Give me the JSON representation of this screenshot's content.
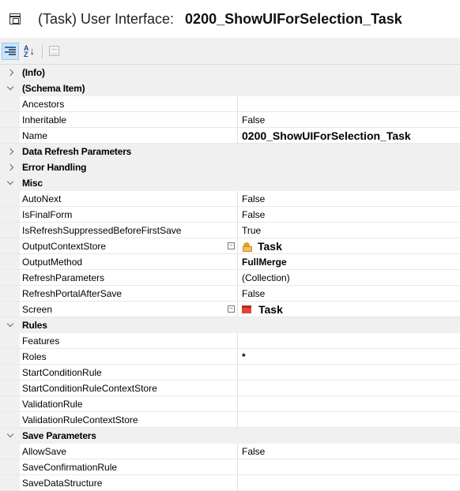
{
  "title": {
    "prefix": "(Task) User Interface:",
    "name": "0200_ShowUIForSelection_Task"
  },
  "toolbar": {
    "categorized_icon": "categorized-icon",
    "alphabetical_icon": "sort-az-icon",
    "az_top": "A",
    "az_bottom": "Z",
    "az_arrow": "↓",
    "property_pages_icon": "property-pages-icon"
  },
  "categories": {
    "info": {
      "label": "(Info)"
    },
    "schema": {
      "label": "(Schema Item)",
      "rows": [
        {
          "name": "Ancestors",
          "value": ""
        },
        {
          "name": "Inheritable",
          "value": "False"
        },
        {
          "name": "Name",
          "value": "0200_ShowUIForSelection_Task"
        }
      ]
    },
    "data_refresh": {
      "label": "Data Refresh Parameters"
    },
    "error_handling": {
      "label": "Error Handling"
    },
    "misc": {
      "label": "Misc",
      "rows": [
        {
          "name": "AutoNext",
          "value": "False"
        },
        {
          "name": "IsFinalForm",
          "value": "False"
        },
        {
          "name": "IsRefreshSuppressedBeforeFirstSave",
          "value": "True"
        },
        {
          "name": "OutputContextStore",
          "value": "Task"
        },
        {
          "name": "OutputMethod",
          "value": "FullMerge"
        },
        {
          "name": "RefreshParameters",
          "value": "(Collection)"
        },
        {
          "name": "RefreshPortalAfterSave",
          "value": "False"
        },
        {
          "name": "Screen",
          "value": "Task"
        }
      ]
    },
    "rules": {
      "label": "Rules",
      "rows": [
        {
          "name": "Features",
          "value": ""
        },
        {
          "name": "Roles",
          "value": "*"
        },
        {
          "name": "StartConditionRule",
          "value": ""
        },
        {
          "name": "StartConditionRuleContextStore",
          "value": ""
        },
        {
          "name": "ValidationRule",
          "value": ""
        },
        {
          "name": "ValidationRuleContextStore",
          "value": ""
        }
      ]
    },
    "save": {
      "label": "Save Parameters",
      "rows": [
        {
          "name": "AllowSave",
          "value": "False"
        },
        {
          "name": "SaveConfirmationRule",
          "value": ""
        },
        {
          "name": "SaveDataStructure",
          "value": ""
        }
      ]
    }
  },
  "colors": {
    "category_background": "#f0f0f0",
    "grid_line": "#e8e8e8",
    "screen_icon": "#e0443a",
    "store_icon": "#e0a030"
  }
}
